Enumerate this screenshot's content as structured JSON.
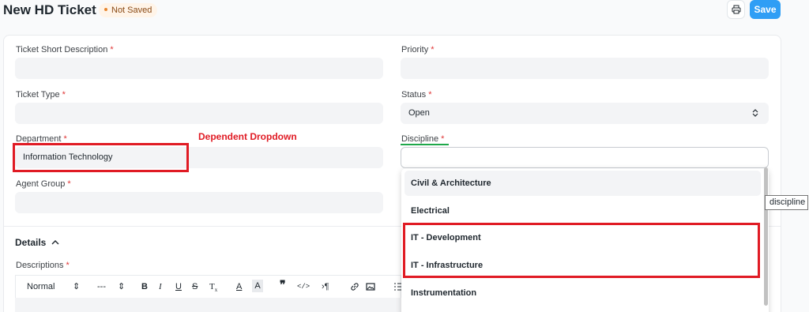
{
  "header": {
    "title": "New HD Ticket",
    "status": "Not Saved",
    "save_label": "Save"
  },
  "form": {
    "short_description": {
      "label": "Ticket Short Description",
      "value": ""
    },
    "priority": {
      "label": "Priority",
      "value": ""
    },
    "ticket_type": {
      "label": "Ticket Type",
      "value": ""
    },
    "status": {
      "label": "Status",
      "value": "Open"
    },
    "department": {
      "label": "Department",
      "value": "Information Technology"
    },
    "discipline": {
      "label": "Discipline",
      "value": ""
    },
    "agent_group": {
      "label": "Agent Group",
      "value": ""
    },
    "required_mark": "*"
  },
  "annotation": {
    "title": "Dependent Dropdown"
  },
  "details": {
    "title": "Details",
    "descriptions_label": "Descriptions",
    "toolbar": {
      "style": "Normal",
      "size": "---"
    }
  },
  "discipline_dropdown": {
    "options": [
      "Civil & Architecture",
      "Electrical",
      "IT - Development",
      "IT - Infrastructure",
      "Instrumentation"
    ]
  },
  "tooltip": "discipline",
  "colors": {
    "annotation_red": "#e01b24",
    "annotation_green": "#1fa84a",
    "primary": "#2f9ef5"
  }
}
